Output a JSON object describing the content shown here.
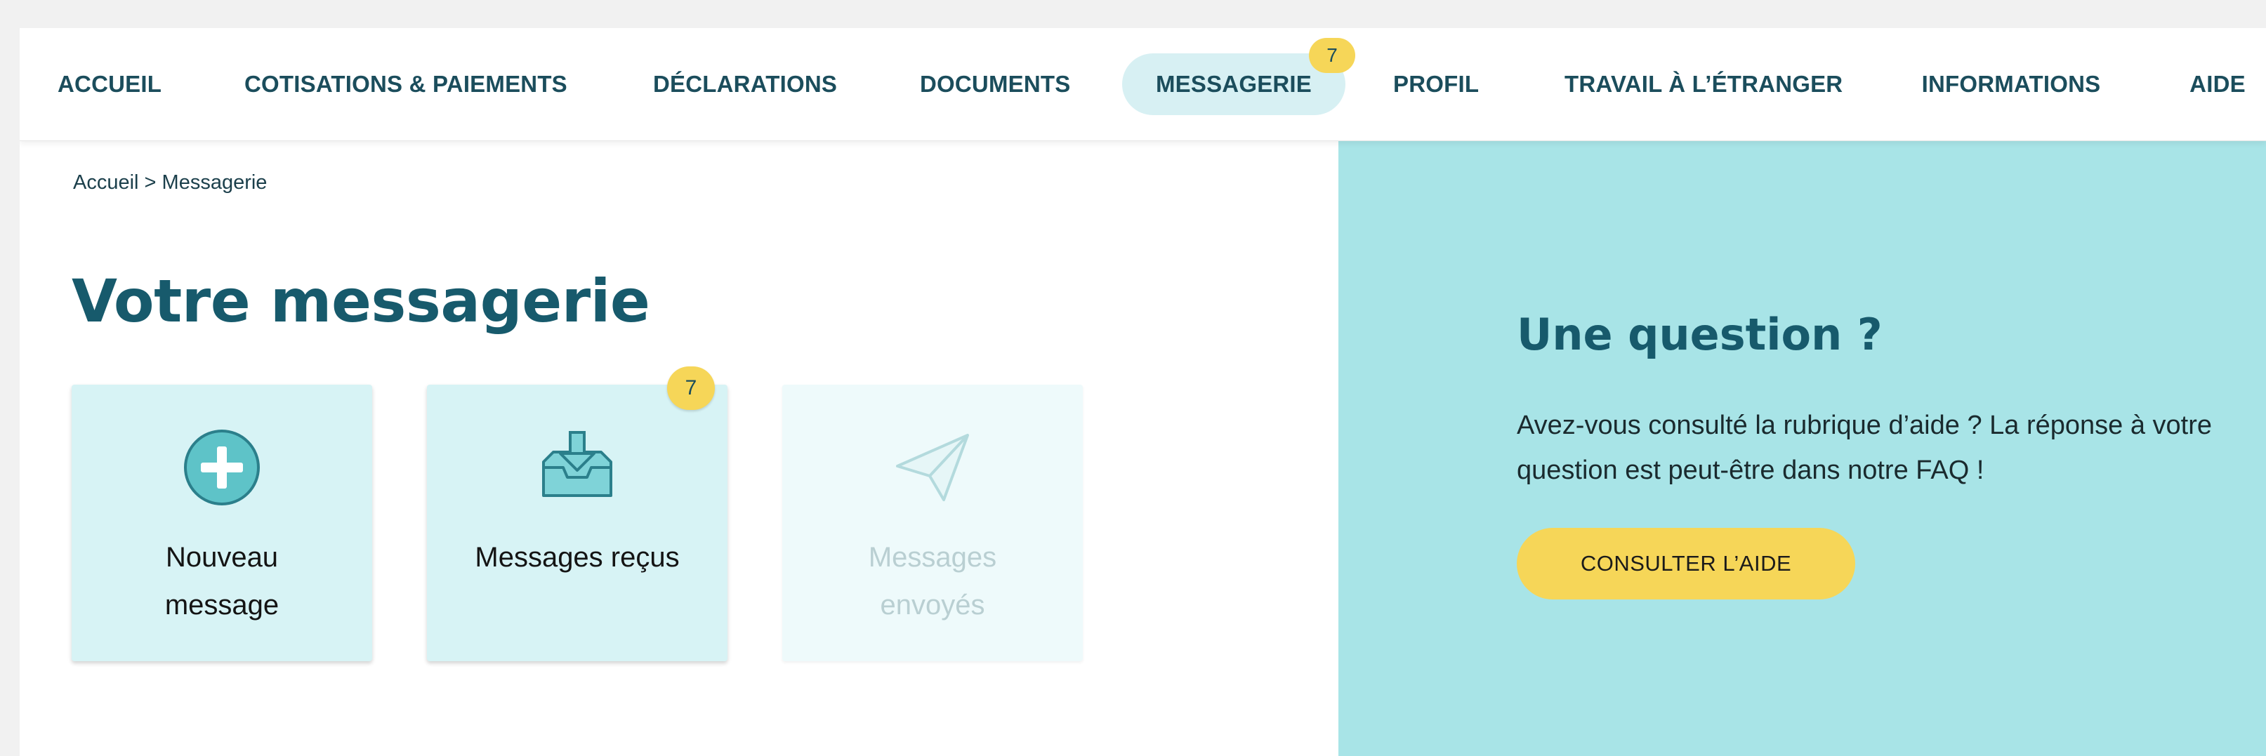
{
  "nav": {
    "items": [
      {
        "label": "ACCUEIL"
      },
      {
        "label": "COTISATIONS & PAIEMENTS"
      },
      {
        "label": "DÉCLARATIONS"
      },
      {
        "label": "DOCUMENTS"
      },
      {
        "label": "MESSAGERIE",
        "badge": "7",
        "active": true
      },
      {
        "label": "PROFIL"
      },
      {
        "label": "TRAVAIL À L’ÉTRANGER"
      },
      {
        "label": "INFORMATIONS"
      },
      {
        "label": "AIDE"
      }
    ]
  },
  "breadcrumb": "Accueil > Messagerie",
  "page_title": "Votre messagerie",
  "cards": [
    {
      "label": "Nouveau message",
      "icon": "plus-circle-icon",
      "enabled": true
    },
    {
      "label": "Messages reçus",
      "icon": "inbox-icon",
      "badge": "7",
      "enabled": true
    },
    {
      "label": "Messages envoyés",
      "icon": "paper-plane-icon",
      "enabled": false
    }
  ],
  "help": {
    "title": "Une question ?",
    "text": "Avez-vous consulté la rubrique d’aide ? La réponse à votre question est peut-être dans notre FAQ !",
    "button_label": "CONSULTER L’AIDE"
  },
  "colors": {
    "brand_dark": "#175a6c",
    "accent_light": "#d7f3f5",
    "help_bg": "#a8e4e7",
    "badge_yellow": "#f6d658"
  }
}
